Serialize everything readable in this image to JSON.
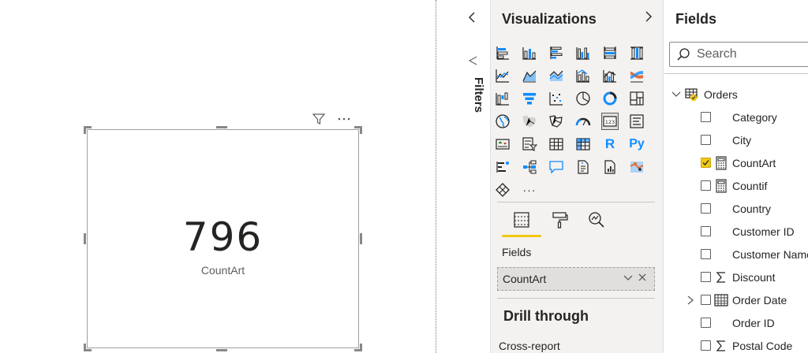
{
  "card": {
    "value": "796",
    "label": "CountArt"
  },
  "filters": {
    "label": "Filters"
  },
  "visualizations": {
    "title": "Visualizations",
    "more_label": "···",
    "tabs": [
      "fields",
      "format",
      "analytics"
    ],
    "fields_label": "Fields",
    "field_well_value": "CountArt",
    "drill_through_title": "Drill through",
    "cross_report_label": "Cross-report",
    "r_label": "R",
    "py_label": "Py",
    "card_icon_label": "123"
  },
  "fields_pane": {
    "title": "Fields",
    "search_placeholder": "Search",
    "table_name": "Orders",
    "items": [
      {
        "label": "Category",
        "checked": false,
        "type": "text"
      },
      {
        "label": "City",
        "checked": false,
        "type": "text"
      },
      {
        "label": "CountArt",
        "checked": true,
        "type": "measure"
      },
      {
        "label": "Countif",
        "checked": false,
        "type": "measure"
      },
      {
        "label": "Country",
        "checked": false,
        "type": "text"
      },
      {
        "label": "Customer ID",
        "checked": false,
        "type": "text"
      },
      {
        "label": "Customer Name",
        "checked": false,
        "type": "text"
      },
      {
        "label": "Discount",
        "checked": false,
        "type": "sum"
      },
      {
        "label": "Order Date",
        "checked": false,
        "type": "date"
      },
      {
        "label": "Order ID",
        "checked": false,
        "type": "text"
      },
      {
        "label": "Postal Code",
        "checked": false,
        "type": "sum"
      }
    ]
  },
  "colors": {
    "accent": "#f2c811",
    "pane_bg": "#f3f2f1",
    "text": "#252423"
  }
}
